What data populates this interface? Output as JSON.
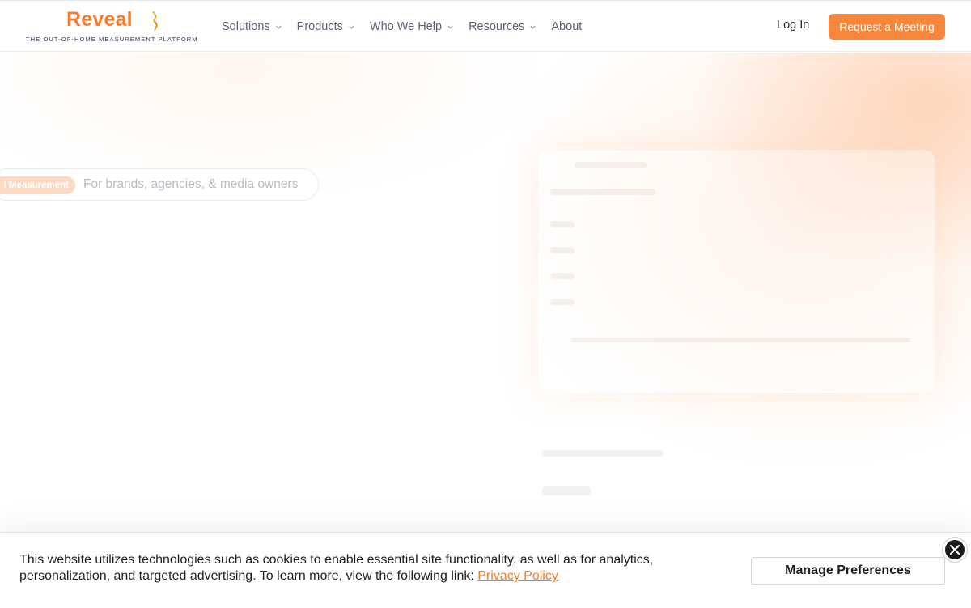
{
  "brand": {
    "name": "Reveal",
    "tagline": "THE OUT-OF-HOME MEASUREMENT PLATFORM",
    "accent": "#f47c2a"
  },
  "nav": {
    "items": [
      {
        "label": "Solutions",
        "has_dropdown": true
      },
      {
        "label": "Products",
        "has_dropdown": true
      },
      {
        "label": "Who We Help",
        "has_dropdown": true
      },
      {
        "label": "Resources",
        "has_dropdown": true
      },
      {
        "label": "About",
        "has_dropdown": false
      }
    ],
    "login_label": "Log In",
    "cta_label": "Request a Meeting",
    "cta_color": "#f5863b"
  },
  "hero": {
    "badge_label": "l Measurement",
    "audience_text": "For brands, agencies, & media owners"
  },
  "cookie_banner": {
    "message": "This website utilizes technologies such as cookies to enable essential site functionality, as well as for analytics, personalization, and targeted advertising. To learn more, view the following link: ",
    "link_label": "Privacy Policy",
    "manage_label": "Manage Preferences",
    "close_icon": "close-icon"
  }
}
